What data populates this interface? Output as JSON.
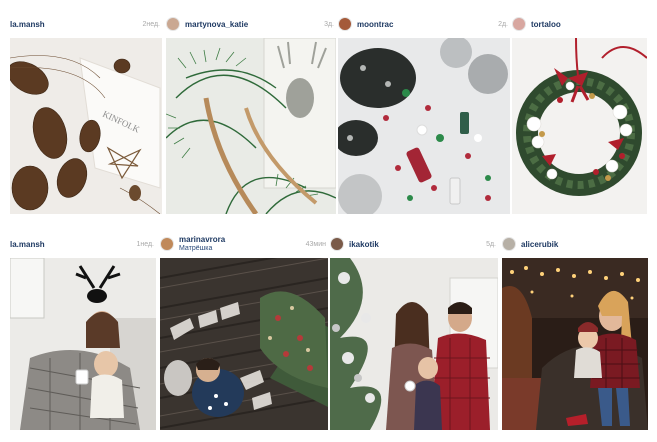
{
  "posts": [
    {
      "username": "la.mansh",
      "time": "2нед.",
      "image": "pinecones-wooden-star-kinfolk-book"
    },
    {
      "username": "martynova_katie",
      "time": "3д.",
      "image": "pine-wreath-deer-card"
    },
    {
      "username": "moontrac",
      "time": "2д.",
      "image": "ornaments-pinecones-nail-polish"
    },
    {
      "username": "tortaloo",
      "time": "",
      "image": "christmas-wreath-red-bows"
    },
    {
      "username": "la.mansh",
      "time": "1нед.",
      "image": "mother-child-reindeer-wall"
    },
    {
      "username": "marinavrora",
      "subtitle": "Матрёшка",
      "time": "43мин",
      "image": "baby-floor-christmas-tree"
    },
    {
      "username": "ikakotik",
      "time": "5д.",
      "image": "family-by-christmas-tree"
    },
    {
      "username": "alicerubik",
      "time": "",
      "image": "mother-daughter-fairy-lights"
    }
  ]
}
